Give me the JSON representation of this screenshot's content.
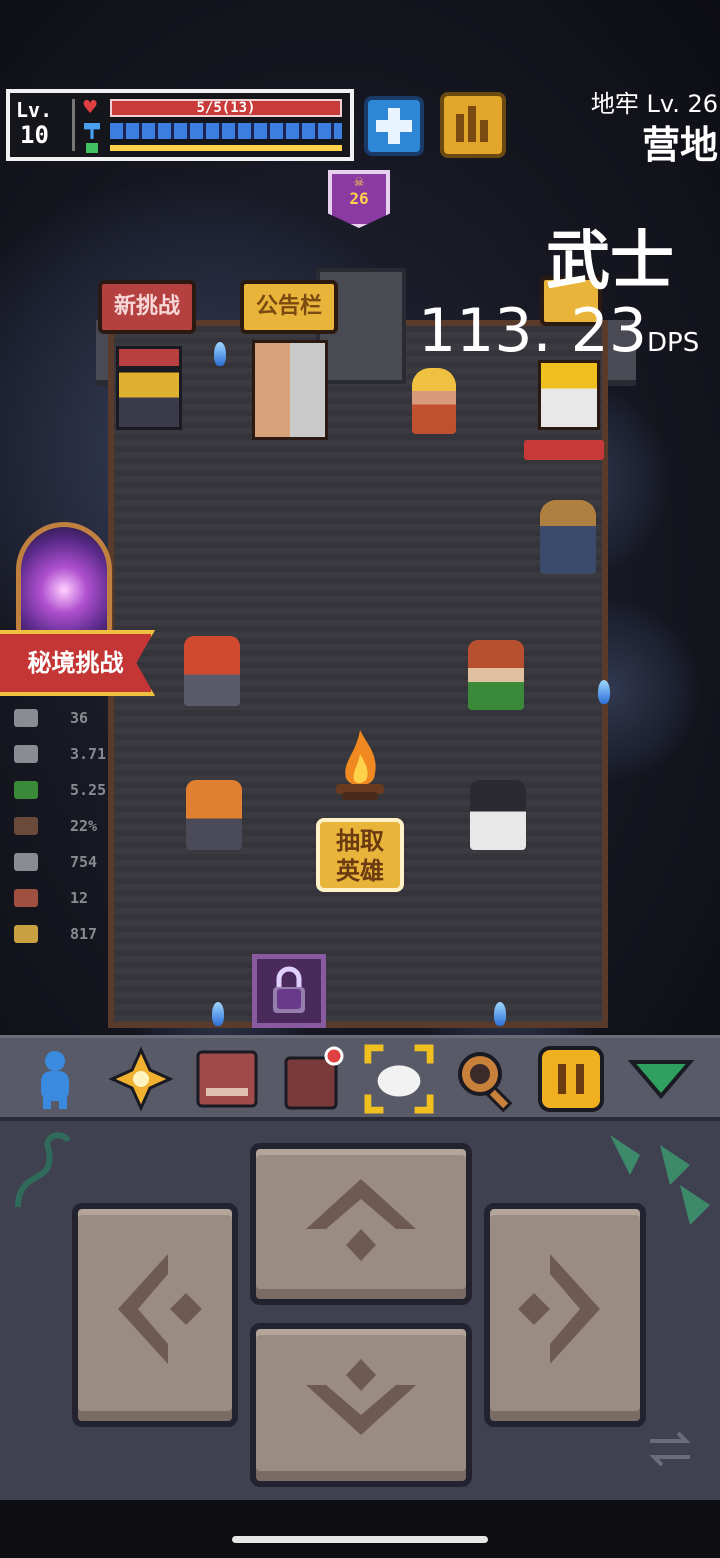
{
  "hud": {
    "level_label": "Lv.",
    "level": "10",
    "hp_text": "5/5(13)"
  },
  "dungeon": {
    "label": "地牢 Lv. 26",
    "area": "营地",
    "badge_level": "26"
  },
  "hero": {
    "class_name": "武士",
    "dps_value": "113. 23",
    "dps_unit": "DPS"
  },
  "signs": {
    "new_challenge": "新挑战",
    "bulletin": "公告栏"
  },
  "secret_challenge": "秘境挑战",
  "draw_hero": "抽取\n英雄",
  "stats": [
    {
      "icon": "crossed-swords-icon",
      "value": "36",
      "color": "#8a8c94"
    },
    {
      "icon": "sword-icon",
      "value": "3.71",
      "color": "#8a8c94"
    },
    {
      "icon": "boot-icon",
      "value": "5.25",
      "color": "#3a8a3a"
    },
    {
      "icon": "shield-round-icon",
      "value": "22%",
      "color": "#6a4a3a"
    },
    {
      "icon": "key-gray-icon",
      "value": "754",
      "color": "#8a8c94"
    },
    {
      "icon": "key-red-icon",
      "value": "12",
      "color": "#a05040"
    },
    {
      "icon": "coin-stack-icon",
      "value": "817",
      "color": "#c8a040"
    }
  ],
  "toolbar": [
    {
      "name": "hero-figure-icon",
      "color": "#3a8ae0"
    },
    {
      "name": "sparkle-icon",
      "color": "#f0b030"
    },
    {
      "name": "book-icon",
      "color": "#a04a4a"
    },
    {
      "name": "bag-icon",
      "color": "#7a3a3a"
    },
    {
      "name": "expand-frame-icon",
      "color": "#f0c020"
    },
    {
      "name": "magnifier-icon",
      "color": "#c8803a"
    },
    {
      "name": "pause-icon",
      "color": "#f0b020"
    },
    {
      "name": "collapse-triangle-icon",
      "color": "#30a060"
    }
  ]
}
